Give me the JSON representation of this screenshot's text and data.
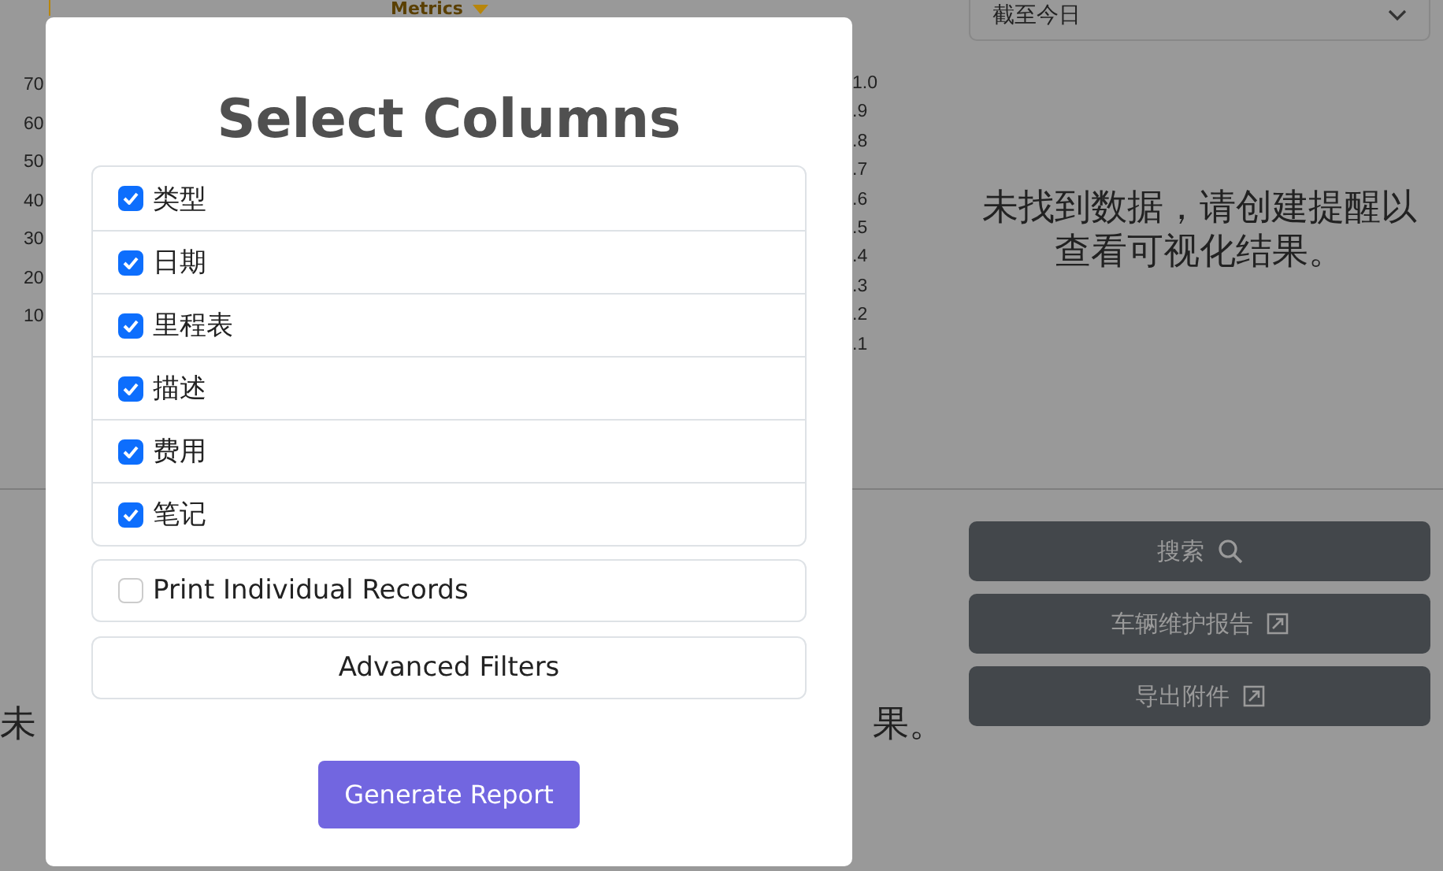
{
  "chart_panel": {
    "metrics_tab": "Metrics",
    "left_ticks": [
      "70",
      "60",
      "50",
      "40",
      "30",
      "20",
      "10"
    ],
    "right_ticks": [
      "1.0",
      ".9",
      ".8",
      ".7",
      ".6",
      ".5",
      ".4",
      ".3",
      ".2",
      ".1"
    ]
  },
  "date_select": {
    "value": "截至今日"
  },
  "right_message": "未找到数据，请创建提醒以查看可视化结果。",
  "actions": [
    {
      "label": "搜索",
      "kind": "search"
    },
    {
      "label": "车辆维护报告",
      "kind": "external"
    },
    {
      "label": "导出附件",
      "kind": "external"
    }
  ],
  "bottom_message": {
    "left_part": "未",
    "right_part": "果。"
  },
  "modal": {
    "title": "Select Columns",
    "columns": [
      {
        "label": "类型",
        "checked": true
      },
      {
        "label": "日期",
        "checked": true
      },
      {
        "label": "里程表",
        "checked": true
      },
      {
        "label": "描述",
        "checked": true
      },
      {
        "label": "费用",
        "checked": true
      },
      {
        "label": "笔记",
        "checked": true
      }
    ],
    "print_individual": {
      "label": "Print Individual Records",
      "checked": false
    },
    "advanced_filters": "Advanced Filters",
    "generate_button": "Generate Report"
  }
}
